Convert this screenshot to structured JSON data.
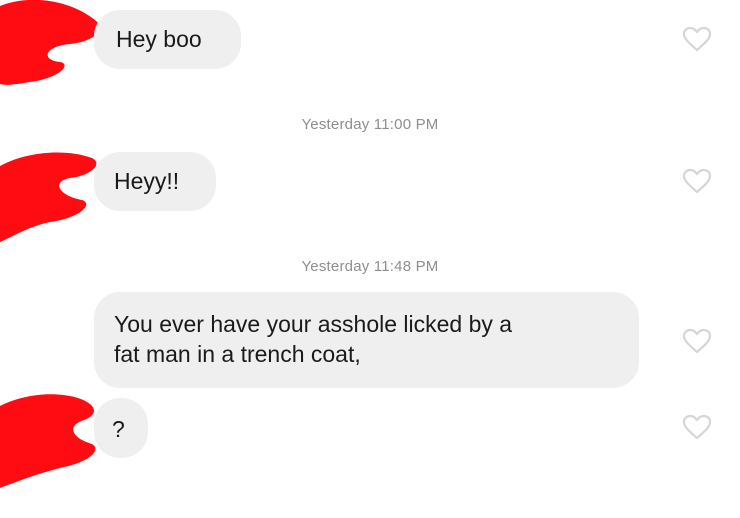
{
  "conversation": {
    "messages": [
      {
        "text": "Hey boo"
      },
      {
        "text": "Heyy!!"
      },
      {
        "text_lines": [
          "You ever have your asshole licked by a",
          "fat man in a trench coat,"
        ]
      },
      {
        "text": "?"
      }
    ],
    "timestamps": [
      {
        "text": "Yesterday 11:00 PM"
      },
      {
        "text": "Yesterday 11:48 PM"
      }
    ]
  },
  "icons": {
    "like": "heart-outline-icon",
    "avatar_redaction": "red-scribble"
  },
  "colors": {
    "bubble": "#efefef",
    "timestamp": "#8e8e8e",
    "redaction": "#ff0b12",
    "heart_outline": "#d6d6d6"
  }
}
